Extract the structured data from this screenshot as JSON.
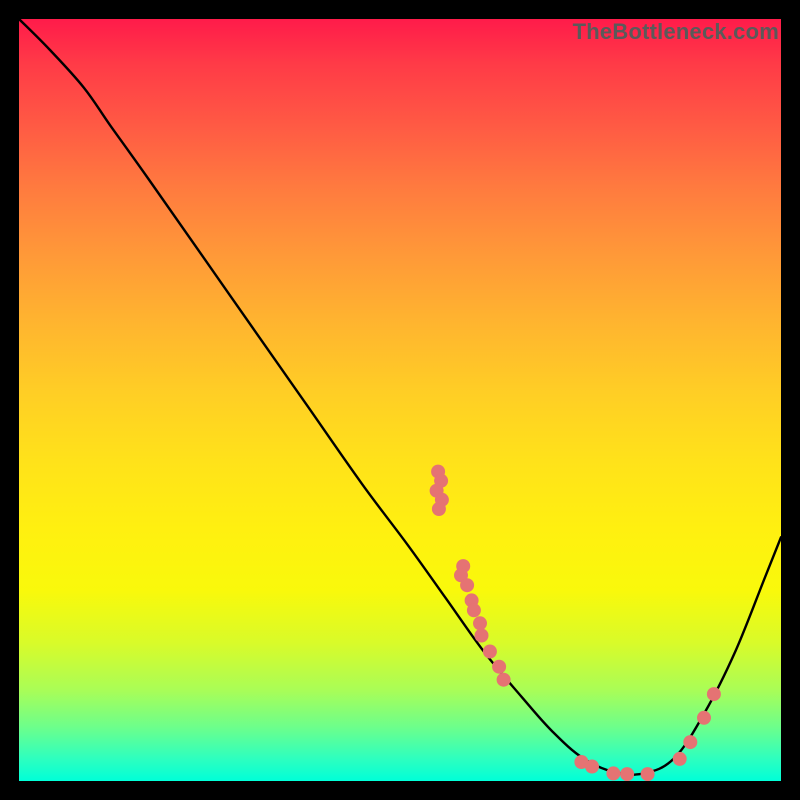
{
  "watermark": "TheBottleneck.com",
  "chart_data": {
    "type": "line",
    "title": "",
    "xlabel": "",
    "ylabel": "",
    "xlim": [
      0,
      1
    ],
    "ylim": [
      0,
      1
    ],
    "curve": [
      {
        "x": 0.0,
        "y": 1.0
      },
      {
        "x": 0.04,
        "y": 0.96
      },
      {
        "x": 0.085,
        "y": 0.91
      },
      {
        "x": 0.12,
        "y": 0.86
      },
      {
        "x": 0.17,
        "y": 0.79
      },
      {
        "x": 0.24,
        "y": 0.69
      },
      {
        "x": 0.31,
        "y": 0.59
      },
      {
        "x": 0.38,
        "y": 0.49
      },
      {
        "x": 0.45,
        "y": 0.39
      },
      {
        "x": 0.51,
        "y": 0.31
      },
      {
        "x": 0.56,
        "y": 0.24
      },
      {
        "x": 0.61,
        "y": 0.17
      },
      {
        "x": 0.66,
        "y": 0.11
      },
      {
        "x": 0.7,
        "y": 0.065
      },
      {
        "x": 0.74,
        "y": 0.03
      },
      {
        "x": 0.78,
        "y": 0.012
      },
      {
        "x": 0.82,
        "y": 0.01
      },
      {
        "x": 0.86,
        "y": 0.03
      },
      {
        "x": 0.9,
        "y": 0.09
      },
      {
        "x": 0.94,
        "y": 0.17
      },
      {
        "x": 0.98,
        "y": 0.27
      },
      {
        "x": 1.0,
        "y": 0.32
      }
    ],
    "points": [
      {
        "x": 0.55,
        "y": 0.406
      },
      {
        "x": 0.554,
        "y": 0.394
      },
      {
        "x": 0.548,
        "y": 0.381
      },
      {
        "x": 0.555,
        "y": 0.369
      },
      {
        "x": 0.551,
        "y": 0.357
      },
      {
        "x": 0.583,
        "y": 0.282
      },
      {
        "x": 0.58,
        "y": 0.27
      },
      {
        "x": 0.588,
        "y": 0.257
      },
      {
        "x": 0.594,
        "y": 0.237
      },
      {
        "x": 0.597,
        "y": 0.224
      },
      {
        "x": 0.605,
        "y": 0.207
      },
      {
        "x": 0.607,
        "y": 0.191
      },
      {
        "x": 0.618,
        "y": 0.17
      },
      {
        "x": 0.63,
        "y": 0.15
      },
      {
        "x": 0.636,
        "y": 0.133
      },
      {
        "x": 0.738,
        "y": 0.025
      },
      {
        "x": 0.752,
        "y": 0.019
      },
      {
        "x": 0.78,
        "y": 0.01
      },
      {
        "x": 0.798,
        "y": 0.009
      },
      {
        "x": 0.825,
        "y": 0.009
      },
      {
        "x": 0.867,
        "y": 0.029
      },
      {
        "x": 0.881,
        "y": 0.051
      },
      {
        "x": 0.899,
        "y": 0.083
      },
      {
        "x": 0.912,
        "y": 0.114
      }
    ],
    "colors": {
      "curve": "#000000",
      "points_fill": "#e57373",
      "points_stroke": "#d9534f"
    }
  }
}
